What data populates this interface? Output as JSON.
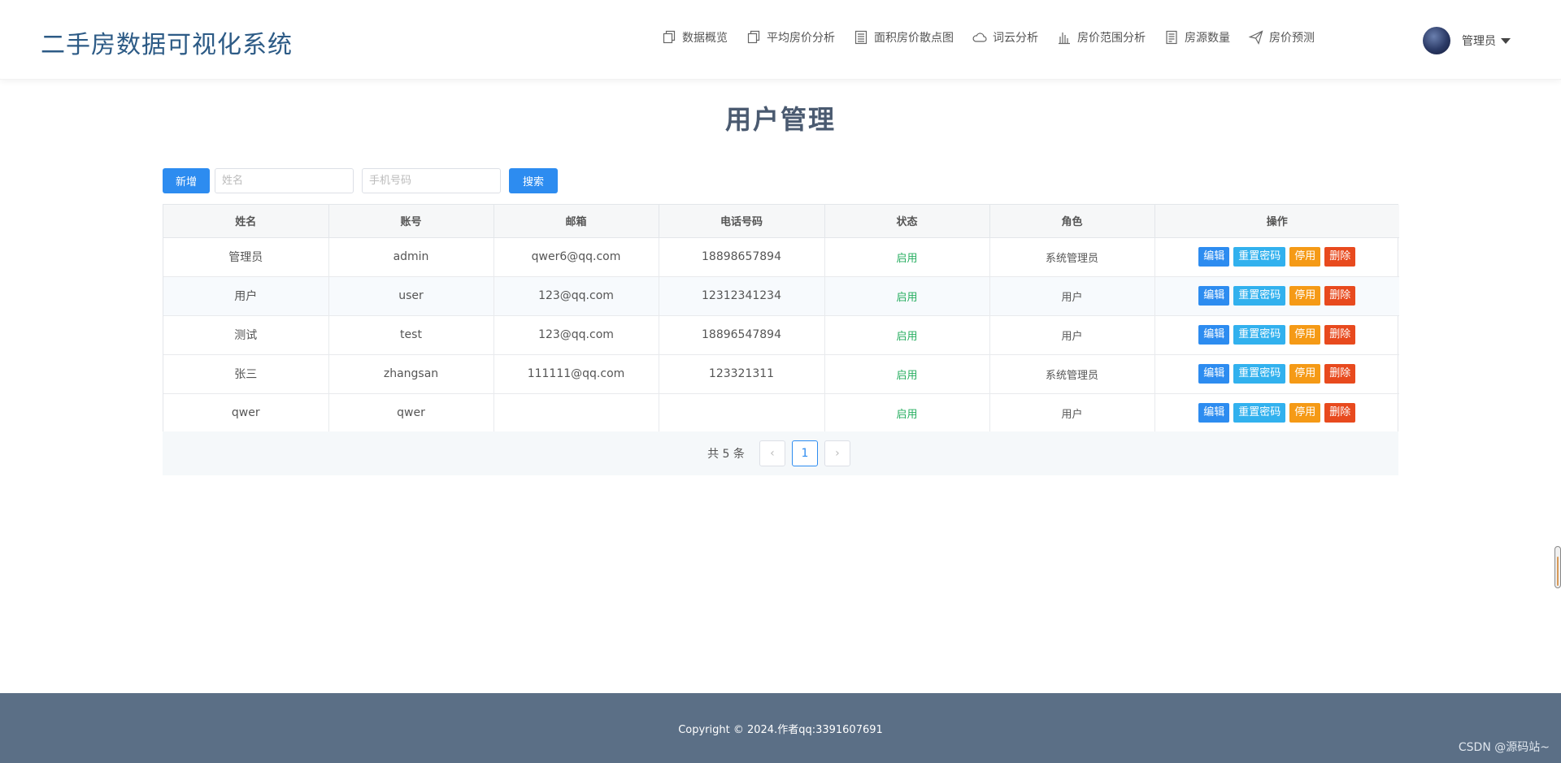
{
  "header": {
    "brand": "二手房数据可视化系统",
    "nav": [
      {
        "label": "数据概览",
        "icon": "overview-icon"
      },
      {
        "label": "平均房价分析",
        "icon": "average-price-icon"
      },
      {
        "label": "面积房价散点图",
        "icon": "scatter-list-icon"
      },
      {
        "label": "词云分析",
        "icon": "cloud-icon"
      },
      {
        "label": "房价范围分析",
        "icon": "bar-chart-icon"
      },
      {
        "label": "房源数量",
        "icon": "document-icon"
      },
      {
        "label": "房价预测",
        "icon": "send-icon"
      }
    ],
    "user": "管理员"
  },
  "main": {
    "title": "用户管理",
    "toolbar": {
      "add_label": "新增",
      "name_placeholder": "姓名",
      "phone_placeholder": "手机号码",
      "search_label": "搜索"
    },
    "table": {
      "columns": [
        "姓名",
        "账号",
        "邮箱",
        "电话号码",
        "状态",
        "角色",
        "操作"
      ],
      "rows": [
        {
          "name": "管理员",
          "account": "admin",
          "email": "qwer6@qq.com",
          "phone": "18898657894",
          "status": "启用",
          "role": "系统管理员"
        },
        {
          "name": "用户",
          "account": "user",
          "email": "123@qq.com",
          "phone": "12312341234",
          "status": "启用",
          "role": "用户"
        },
        {
          "name": "测试",
          "account": "test",
          "email": "123@qq.com",
          "phone": "18896547894",
          "status": "启用",
          "role": "用户"
        },
        {
          "name": "张三",
          "account": "zhangsan",
          "email": "111111@qq.com",
          "phone": "123321311",
          "status": "启用",
          "role": "系统管理员"
        },
        {
          "name": "qwer",
          "account": "qwer",
          "email": "",
          "phone": "",
          "status": "启用",
          "role": "用户"
        }
      ],
      "actions": {
        "edit": "编辑",
        "reset": "重置密码",
        "disable": "停用",
        "delete": "删除"
      }
    },
    "pagination": {
      "total": "共 5 条",
      "current_page": "1",
      "prev": "‹",
      "next": "›"
    }
  },
  "footer": {
    "copyright": "Copyright © 2024.作者qq:3391607691",
    "watermark": "CSDN @源码站~"
  },
  "colors": {
    "primary": "#2d8cf0",
    "reset": "#32b1ee",
    "disable": "#f59a16",
    "delete": "#e84a1e",
    "status_on": "#27ae60",
    "footer_bg": "#5b6f86"
  }
}
